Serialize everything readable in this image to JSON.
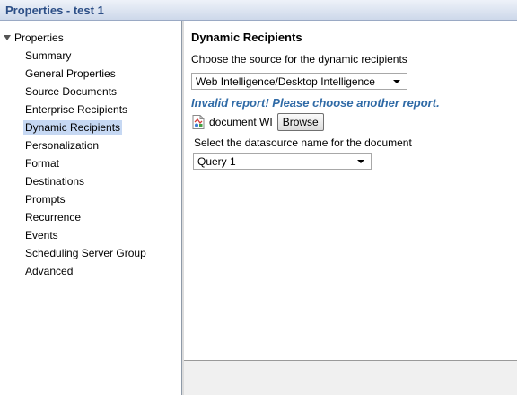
{
  "window": {
    "title": "Properties - test 1"
  },
  "tree": {
    "root_label": "Properties",
    "items": [
      {
        "label": "Summary",
        "selected": false
      },
      {
        "label": "General Properties",
        "selected": false
      },
      {
        "label": "Source Documents",
        "selected": false
      },
      {
        "label": "Enterprise Recipients",
        "selected": false
      },
      {
        "label": "Dynamic Recipients",
        "selected": true
      },
      {
        "label": "Personalization",
        "selected": false
      },
      {
        "label": "Format",
        "selected": false
      },
      {
        "label": "Destinations",
        "selected": false
      },
      {
        "label": "Prompts",
        "selected": false
      },
      {
        "label": "Recurrence",
        "selected": false
      },
      {
        "label": "Events",
        "selected": false
      },
      {
        "label": "Scheduling Server Group",
        "selected": false
      },
      {
        "label": "Advanced",
        "selected": false
      }
    ]
  },
  "main": {
    "section_title": "Dynamic Recipients",
    "source_label": "Choose the source for the dynamic recipients",
    "source_value": "Web Intelligence/Desktop Intelligence",
    "error_message": "Invalid report! Please choose another report.",
    "document_label": "document WI",
    "browse_label": "Browse",
    "datasource_label": "Select the datasource name for the document",
    "datasource_value": "Query 1"
  },
  "colors": {
    "title_text": "#2c4e86",
    "error_text": "#2f6aa6",
    "selection": "#c6d8f3"
  }
}
